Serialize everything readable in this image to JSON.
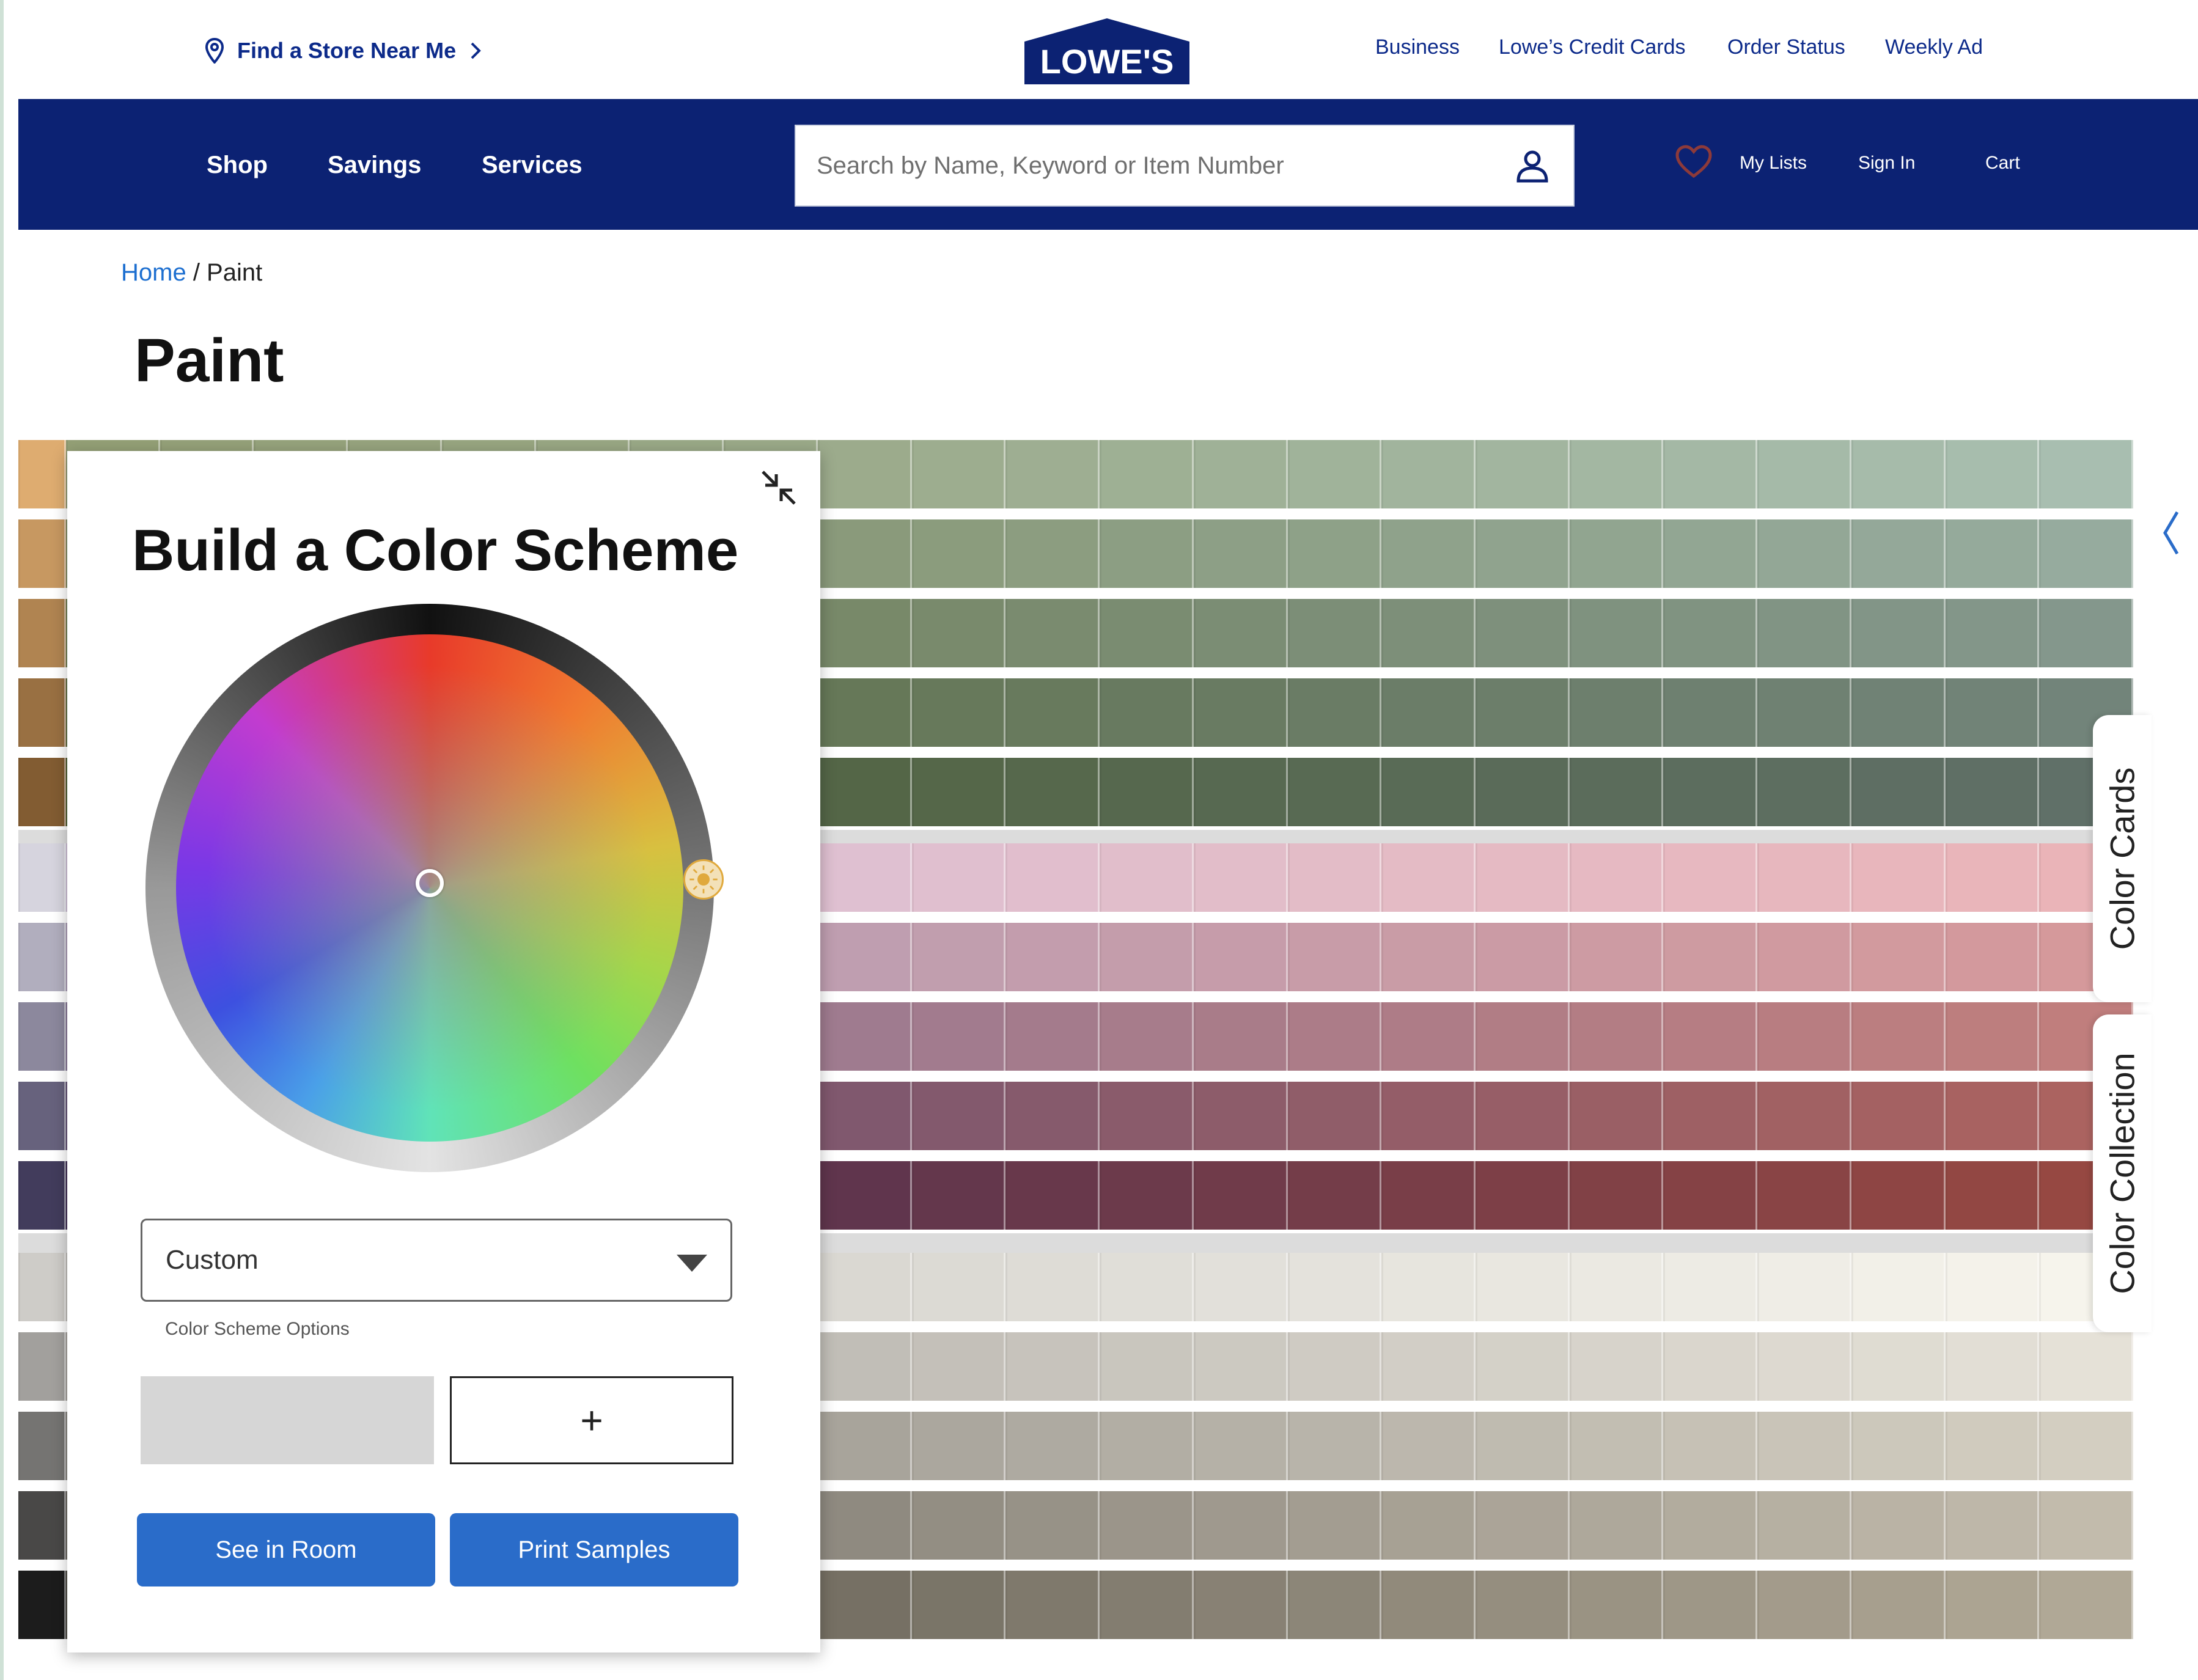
{
  "utility": {
    "find_store": "Find a Store Near Me",
    "logo_text": "LOWE'S",
    "links": [
      "Business",
      "Lowe’s Credit Cards",
      "Order Status",
      "Weekly Ad"
    ]
  },
  "nav": {
    "items": [
      "Shop",
      "Savings",
      "Services"
    ],
    "search_placeholder": "Search by Name, Keyword or Item Number",
    "my_lists": "My Lists",
    "sign_in": "Sign In",
    "cart": "Cart"
  },
  "breadcrumb": {
    "home": "Home",
    "separator": " / ",
    "current": "Paint"
  },
  "page_title": "Paint",
  "side_tabs": {
    "cards": "Color Cards",
    "collection": "Color Collection"
  },
  "panel": {
    "title": "Build a Color Scheme",
    "scheme_select_value": "Custom",
    "scheme_options_label": "Color Scheme Options",
    "add_symbol": "+",
    "see_in_room": "See in Room",
    "print_samples": "Print Samples"
  },
  "colors": {
    "brand_navy": "#0c2273",
    "link_blue": "#0c2a8a",
    "button_blue": "#2a6cc9"
  },
  "icons": [
    "location-pin-icon",
    "chevron-right-icon",
    "account-icon",
    "heart-icon",
    "minimize-icon",
    "brightness-icon",
    "caret-down-icon",
    "chevron-left-icon"
  ]
}
